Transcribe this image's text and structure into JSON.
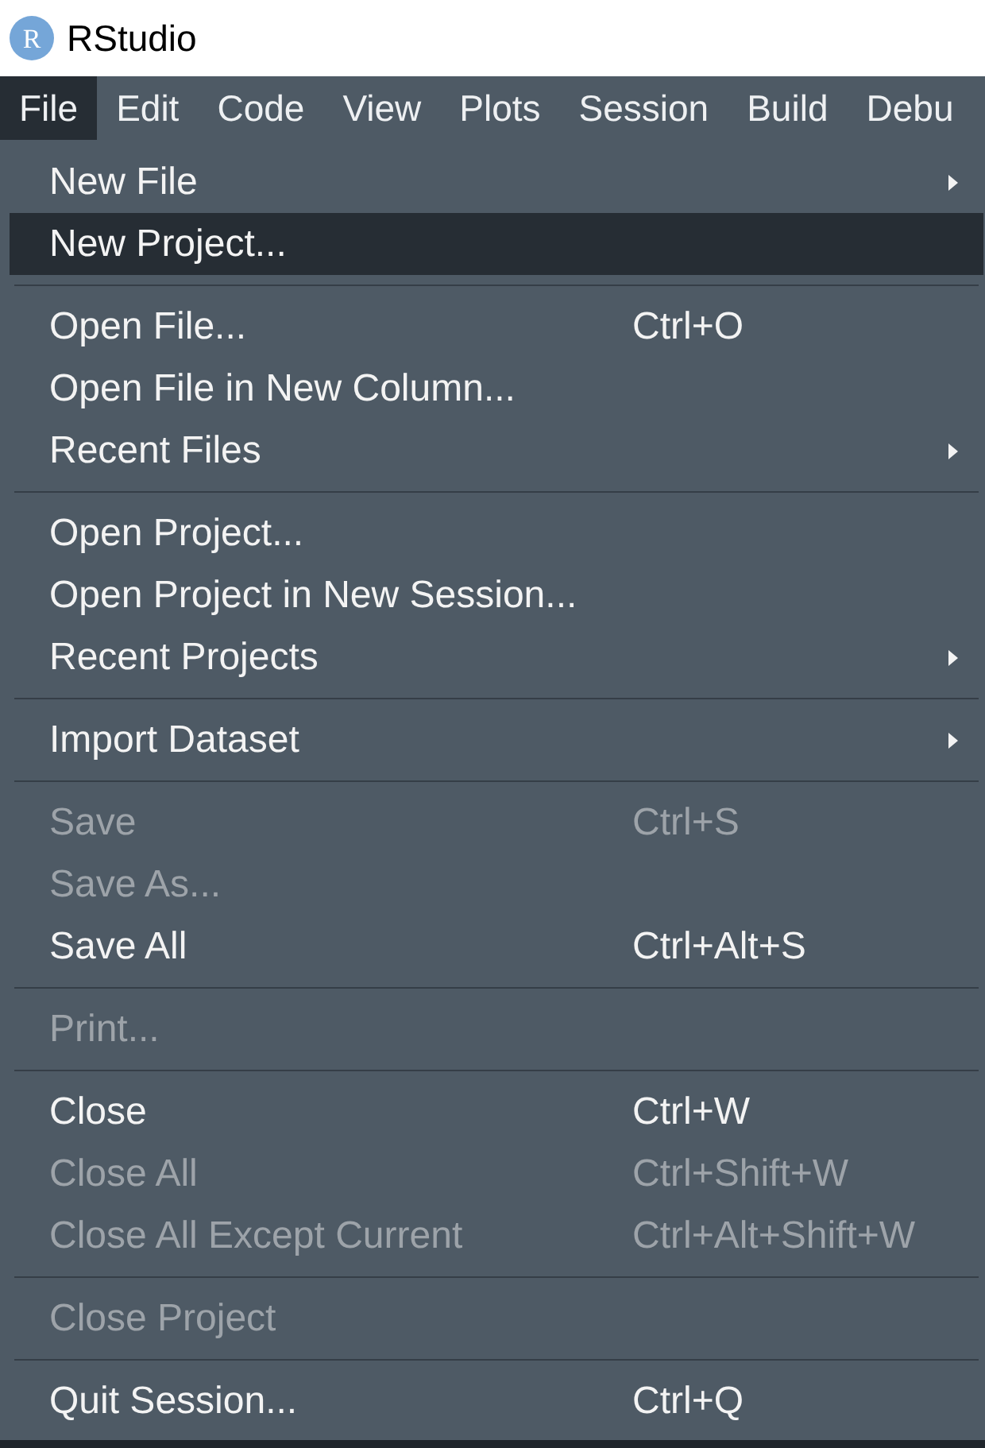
{
  "window": {
    "logo": "R",
    "title": "RStudio"
  },
  "menu_bar": [
    {
      "label": "File",
      "selected": true
    },
    {
      "label": "Edit",
      "selected": false
    },
    {
      "label": "Code",
      "selected": false
    },
    {
      "label": "View",
      "selected": false
    },
    {
      "label": "Plots",
      "selected": false
    },
    {
      "label": "Session",
      "selected": false
    },
    {
      "label": "Build",
      "selected": false
    },
    {
      "label": "Debu",
      "selected": false
    }
  ],
  "file_menu": {
    "groups": [
      {
        "items": [
          {
            "label": "New File",
            "selected": false,
            "disabled": false,
            "submenu": true
          },
          {
            "label": "New Project...",
            "selected": true,
            "disabled": false,
            "submenu": false
          }
        ]
      },
      {
        "items": [
          {
            "label": "Open File...",
            "shortcut": "Ctrl+O",
            "selected": false,
            "disabled": false,
            "submenu": false
          },
          {
            "label": "Open File in New Column...",
            "selected": false,
            "disabled": false,
            "submenu": false
          },
          {
            "label": "Recent Files",
            "selected": false,
            "disabled": false,
            "submenu": true
          }
        ]
      },
      {
        "items": [
          {
            "label": "Open Project...",
            "selected": false,
            "disabled": false,
            "submenu": false
          },
          {
            "label": "Open Project in New Session...",
            "selected": false,
            "disabled": false,
            "submenu": false
          },
          {
            "label": "Recent Projects",
            "selected": false,
            "disabled": false,
            "submenu": true
          }
        ]
      },
      {
        "items": [
          {
            "label": "Import Dataset",
            "selected": false,
            "disabled": false,
            "submenu": true
          }
        ]
      },
      {
        "items": [
          {
            "label": "Save",
            "shortcut": "Ctrl+S",
            "selected": false,
            "disabled": true,
            "submenu": false
          },
          {
            "label": "Save As...",
            "selected": false,
            "disabled": true,
            "submenu": false
          },
          {
            "label": "Save All",
            "shortcut": "Ctrl+Alt+S",
            "selected": false,
            "disabled": false,
            "submenu": false
          }
        ]
      },
      {
        "items": [
          {
            "label": "Print...",
            "selected": false,
            "disabled": true,
            "submenu": false
          }
        ]
      },
      {
        "items": [
          {
            "label": "Close",
            "shortcut": "Ctrl+W",
            "selected": false,
            "disabled": false,
            "submenu": false
          },
          {
            "label": "Close All",
            "shortcut": "Ctrl+Shift+W",
            "selected": false,
            "disabled": true,
            "submenu": false
          },
          {
            "label": "Close All Except Current",
            "shortcut": "Ctrl+Alt+Shift+W",
            "selected": false,
            "disabled": true,
            "submenu": false
          }
        ]
      },
      {
        "items": [
          {
            "label": "Close Project",
            "selected": false,
            "disabled": true,
            "submenu": false
          }
        ]
      },
      {
        "items": [
          {
            "label": "Quit Session...",
            "shortcut": "Ctrl+Q",
            "selected": false,
            "disabled": false,
            "submenu": false
          }
        ]
      }
    ]
  }
}
